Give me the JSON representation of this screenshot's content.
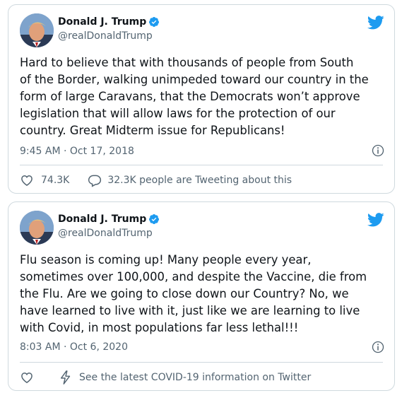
{
  "tweets": [
    {
      "author_name": "Donald J. Trump",
      "handle": "@realDonaldTrump",
      "text": "Hard to believe that with thousands of people from South\nof the Border, walking unimpeded toward our country in the\nform of large Caravans, that the Democrats won’t approve\nlegislation that will allow laws for the protection of our\ncountry. Great Midterm issue for Republicans!",
      "timestamp": "9:45 AM · Oct 17, 2018",
      "likes": "74.3K",
      "replies_text": "32.3K people are Tweeting about this"
    },
    {
      "author_name": "Donald J. Trump",
      "handle": "@realDonaldTrump",
      "text": "Flu season is coming up! Many people every year,\nsometimes over 100,000, and despite the Vaccine, die from\nthe Flu. Are we going to close down our Country? No, we\nhave learned to live with it, just like we are learning to live\nwith Covid, in most populations far less lethal!!!",
      "timestamp": "8:03 AM · Oct 6, 2020",
      "covid_notice": "See the latest COVID-19 information on Twitter"
    }
  ],
  "colors": {
    "accent": "#1d9bf0",
    "muted": "#536471",
    "border": "#cfd9de"
  },
  "icons": [
    "avatar",
    "verified-icon",
    "twitter-bird-icon",
    "info-icon",
    "heart-icon",
    "reply-icon",
    "lightning-icon"
  ]
}
